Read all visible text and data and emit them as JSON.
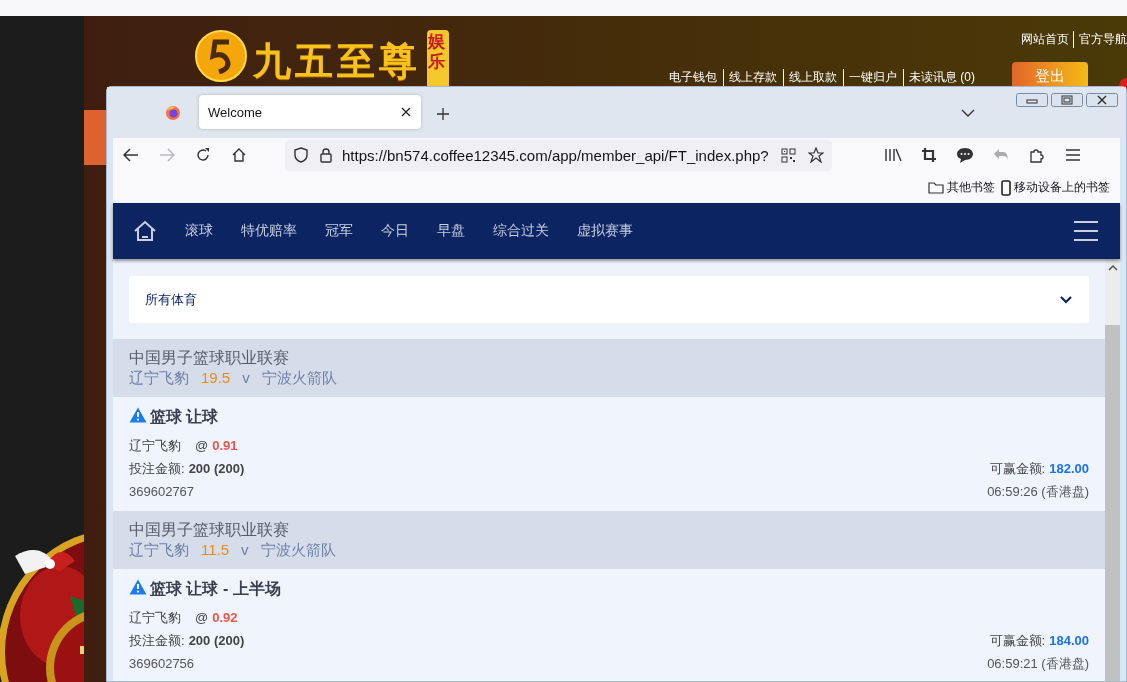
{
  "site": {
    "logo": {
      "name": "九五至尊",
      "badge": "娱乐"
    },
    "top_links": [
      "网站首页",
      "官方导航"
    ],
    "account_links": [
      "电子钱包",
      "线上存款",
      "线上取款",
      "一键归户",
      "未读讯息 (0)"
    ],
    "logout": "登出"
  },
  "browser": {
    "tab": {
      "title": "Welcome",
      "selected": true
    },
    "url": "https://bn574.coffee12345.com/app/member_api/FT_index.php?",
    "forward_disabled": true,
    "bookmarks": [
      "其他书签",
      "移动设备上的书签"
    ]
  },
  "nav": {
    "items": [
      "滚球",
      "特优赔率",
      "冠军",
      "今日",
      "早盘",
      "综合过关",
      "虚拟赛事"
    ]
  },
  "filter": {
    "value": "所有体育"
  },
  "bets": [
    {
      "league": "中国男子篮球职业联赛",
      "home": "辽宁飞豹",
      "handicap": "19.5",
      "vs": "v",
      "away": "宁波火箭队",
      "title": "篮球 让球",
      "pick": "辽宁飞豹",
      "at": "@",
      "odds": "0.91",
      "stake_label": "投注金额:",
      "stake": "200 (200)",
      "win_label": "可赢金额:",
      "win": "182.00",
      "id": "369602767",
      "time": "06:59:26 (香港盘)"
    },
    {
      "league": "中国男子篮球职业联赛",
      "home": "辽宁飞豹",
      "handicap": "11.5",
      "vs": "v",
      "away": "宁波火箭队",
      "title": "篮球 让球 - 上半场",
      "pick": "辽宁飞豹",
      "at": "@",
      "odds": "0.92",
      "stake_label": "投注金额:",
      "stake": "200 (200)",
      "win_label": "可赢金额:",
      "win": "184.00",
      "id": "369602756",
      "time": "06:59:21 (香港盘)"
    }
  ]
}
